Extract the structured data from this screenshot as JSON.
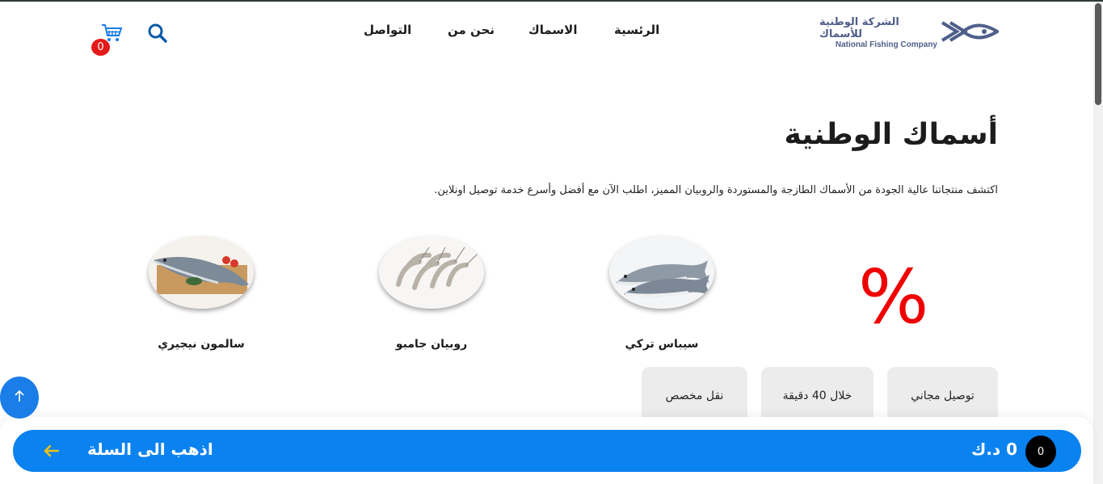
{
  "header": {
    "logo": {
      "name_ar": "الشركة الوطنية للأسماك",
      "name_en": "National Fishing Company",
      "icon": "fish-logo-icon"
    },
    "nav": [
      {
        "label": "الرئسية"
      },
      {
        "label": "الاسماك"
      },
      {
        "label": "نحن من"
      },
      {
        "label": "التواصل"
      }
    ],
    "search_icon": "search-icon",
    "cart": {
      "icon": "cart-icon",
      "count": "0"
    }
  },
  "hero": {
    "title": "أسماك الوطنية",
    "description": "اكتشف منتجاتنا عالية الجودة من الأسماك الطازجة والمستوردة والروبيان المميز، اطلب الآن مع أفضل وأسرع خدمة توصيل اونلاين."
  },
  "offers": {
    "symbol": "%"
  },
  "products": [
    {
      "name": "سيباس تركي"
    },
    {
      "name": "روبيان جامبو"
    },
    {
      "name": "سالمون نيجيري"
    }
  ],
  "features": [
    {
      "label": "توصيل مجاني"
    },
    {
      "label": "خلال 40 دقيقة"
    },
    {
      "label": "نقل مخصص"
    }
  ],
  "scroll_top_icon": "arrow-up-icon",
  "cart_bar": {
    "label": "اذهب الى السلة",
    "arrow_icon": "arrow-left-icon",
    "total": "0 د.ك",
    "count": "0"
  },
  "colors": {
    "primary_blue": "#0a82f0",
    "offer_red": "#f00000",
    "badge_red": "#e41a1a",
    "logo_navy": "#4f5f8a",
    "chip_gray": "#ececec"
  }
}
